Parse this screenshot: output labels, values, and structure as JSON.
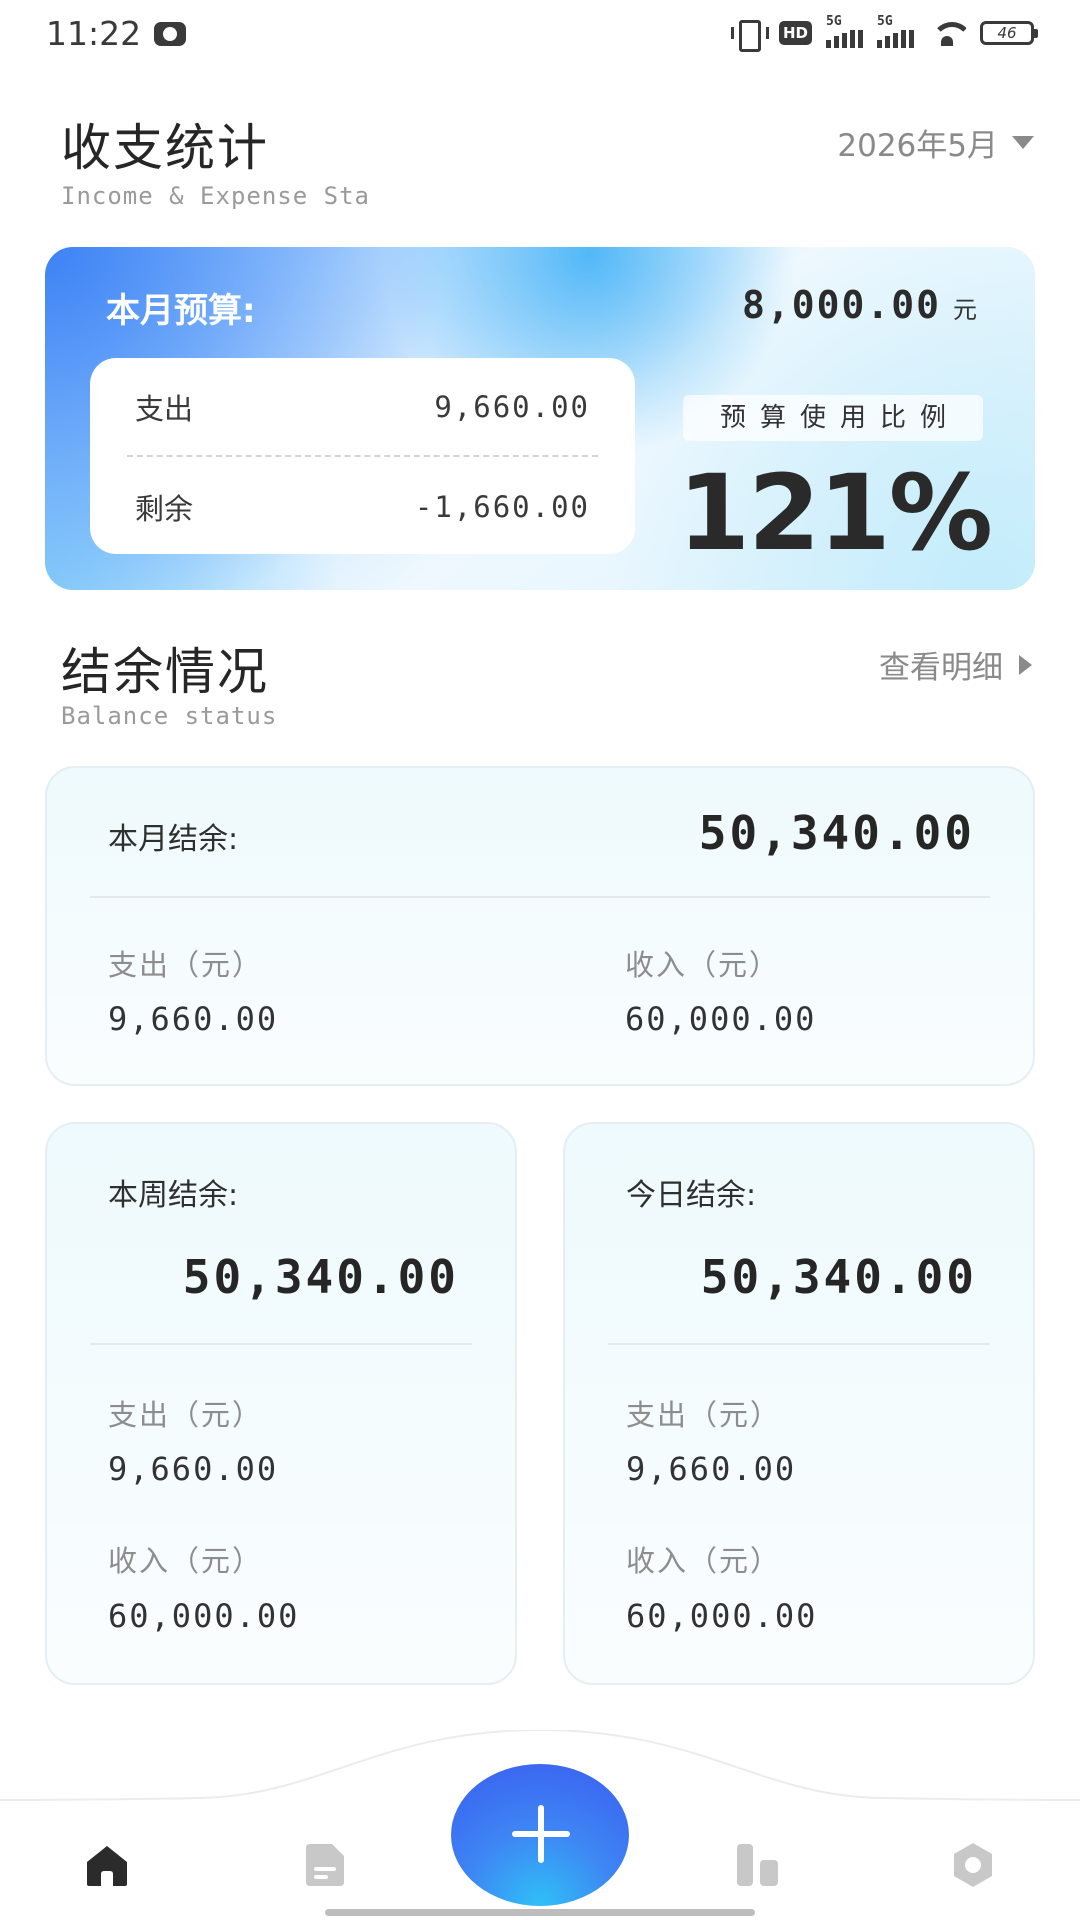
{
  "status_bar": {
    "time": "11:22",
    "hd_label": "HD",
    "sim1_label": "5G",
    "sim2_label": "5G",
    "battery": "46"
  },
  "header": {
    "title": "收支统计",
    "subtitle": "Income & Expense Sta",
    "month": "2026年5月"
  },
  "budget": {
    "label": "本月预算:",
    "amount": "8,000.00",
    "unit": "元",
    "expense_label": "支出",
    "expense_value": "9,660.00",
    "remain_label": "剩余",
    "remain_value": "-1,660.00",
    "ratio_label": "预算使用比例",
    "ratio_value": "121%"
  },
  "balance": {
    "title": "结余情况",
    "subtitle": "Balance status",
    "detail_link": "查看明细",
    "month": {
      "label": "本月结余:",
      "value": "50,340.00",
      "expense_label": "支出（元）",
      "expense_value": "9,660.00",
      "income_label": "收入（元）",
      "income_value": "60,000.00"
    },
    "week": {
      "label": "本周结余:",
      "value": "50,340.00",
      "expense_label": "支出（元）",
      "expense_value": "9,660.00",
      "income_label": "收入（元）",
      "income_value": "60,000.00"
    },
    "today": {
      "label": "今日结余:",
      "value": "50,340.00",
      "expense_label": "支出（元）",
      "expense_value": "9,660.00",
      "income_label": "收入（元）",
      "income_value": "60,000.00"
    }
  },
  "nav": {
    "icons": [
      "home-icon",
      "bill-icon",
      "chart-icon",
      "plus-icon",
      "settings-icon"
    ],
    "active_color": "#2b2b2b",
    "inactive_color": "#c8c8c8"
  },
  "colors": {
    "accent": "#3e86f4",
    "card_gradient_start": "#3d82f5",
    "card_gradient_end": "#dff3fd"
  }
}
